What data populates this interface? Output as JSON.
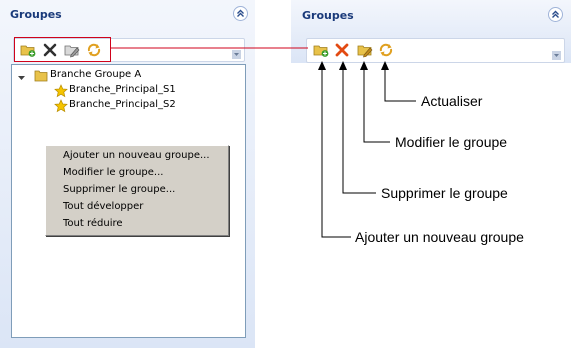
{
  "left_panel": {
    "title": "Groupes",
    "toolbar": {
      "icons": [
        "add-group-icon",
        "delete-icon",
        "edit-group-icon",
        "refresh-icon"
      ]
    },
    "tree": {
      "root": "Branche Groupe A",
      "children": [
        "Branche_Principal_S1",
        "Branche_Principal_S2"
      ]
    },
    "context_menu": [
      "Ajouter un nouveau groupe...",
      "Modifier le groupe...",
      "Supprimer le groupe...",
      "Tout développer",
      "Tout réduire"
    ]
  },
  "right_panel": {
    "title": "Groupes"
  },
  "callouts": {
    "refresh": "Actualiser",
    "edit": "Modifier le groupe",
    "delete": "Supprimer le groupe",
    "add": "Ajouter un nouveau groupe"
  },
  "colors": {
    "panel_bg_top": "#f3f6fc",
    "panel_bg_bottom": "#dbe5f6",
    "title_text": "#1a3a7a",
    "highlight_border": "#d0021b",
    "star": "#f5c400",
    "folder": "#e8c24a"
  }
}
